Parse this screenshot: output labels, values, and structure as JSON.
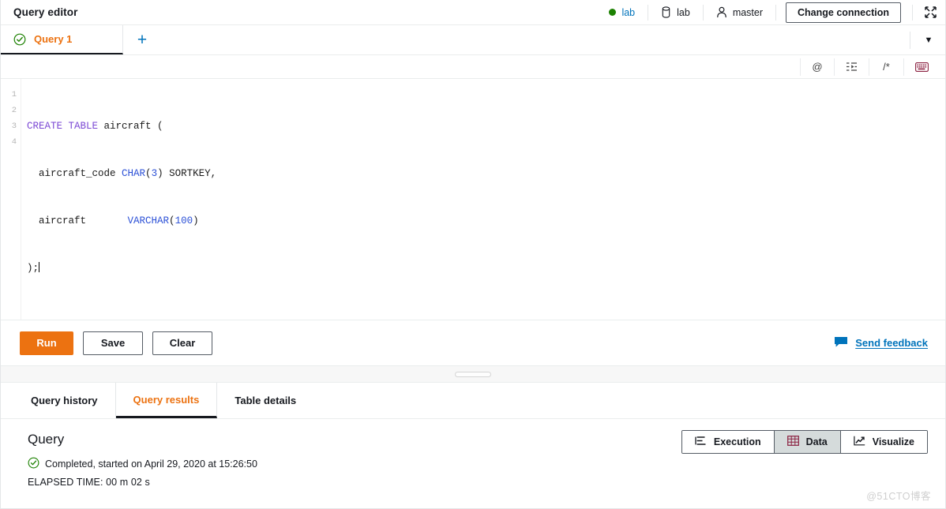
{
  "header": {
    "title": "Query editor",
    "connection": {
      "cluster_label": "lab",
      "cluster_status_color": "#1d8102",
      "database_label": "lab",
      "user_label": "master",
      "change_connection_label": "Change connection",
      "expand_icon": "expand-icon"
    }
  },
  "tabstrip": {
    "tabs": [
      {
        "label": "Query 1",
        "status_icon": "check-circle-icon",
        "active": true
      }
    ],
    "add_tab_label": "+",
    "overflow_caret": "▼"
  },
  "editor_toolbar": {
    "buttons": [
      {
        "icon": "at-sign-icon",
        "glyph": "@"
      },
      {
        "icon": "indent-icon",
        "glyph": ""
      },
      {
        "icon": "comment-block-icon",
        "glyph": "/*"
      },
      {
        "icon": "keyboard-icon",
        "glyph": ""
      }
    ]
  },
  "editor": {
    "line_numbers": [
      "1",
      "2",
      "3",
      "4"
    ],
    "lines": [
      [
        {
          "t": "CREATE TABLE",
          "c": "kw"
        },
        {
          "t": " aircraft (",
          "c": ""
        }
      ],
      [
        {
          "t": "  aircraft_code ",
          "c": ""
        },
        {
          "t": "CHAR",
          "c": "type"
        },
        {
          "t": "(",
          "c": ""
        },
        {
          "t": "3",
          "c": "num"
        },
        {
          "t": ") SORTKEY,",
          "c": ""
        }
      ],
      [
        {
          "t": "  aircraft       ",
          "c": ""
        },
        {
          "t": "VARCHAR",
          "c": "type"
        },
        {
          "t": "(",
          "c": ""
        },
        {
          "t": "100",
          "c": "num"
        },
        {
          "t": ")",
          "c": ""
        }
      ],
      [
        {
          "t": ");",
          "c": ""
        }
      ]
    ],
    "plain_text": "CREATE TABLE aircraft (\n  aircraft_code CHAR(3) SORTKEY,\n  aircraft      VARCHAR(100)\n);"
  },
  "actions": {
    "run_label": "Run",
    "save_label": "Save",
    "clear_label": "Clear",
    "feedback_label": "Send feedback",
    "feedback_icon": "speech-bubble-icon",
    "accent_color": "#ec7211",
    "link_color": "#0073bb"
  },
  "result_tabs": [
    {
      "label": "Query history",
      "active": false
    },
    {
      "label": "Query results",
      "active": true
    },
    {
      "label": "Table details",
      "active": false
    }
  ],
  "result_panel": {
    "title": "Query",
    "status_icon": "check-circle-icon",
    "status_text": "Completed, started on April 29, 2020 at 15:26:50",
    "elapsed_text": "ELAPSED TIME: 00 m 02 s",
    "view_modes": [
      {
        "label": "Execution",
        "icon": "list-icon",
        "selected": false
      },
      {
        "label": "Data",
        "icon": "table-grid-icon",
        "selected": true
      },
      {
        "label": "Visualize",
        "icon": "line-chart-icon",
        "selected": false
      }
    ]
  },
  "watermark": {
    "text": "@51CTO博客"
  }
}
